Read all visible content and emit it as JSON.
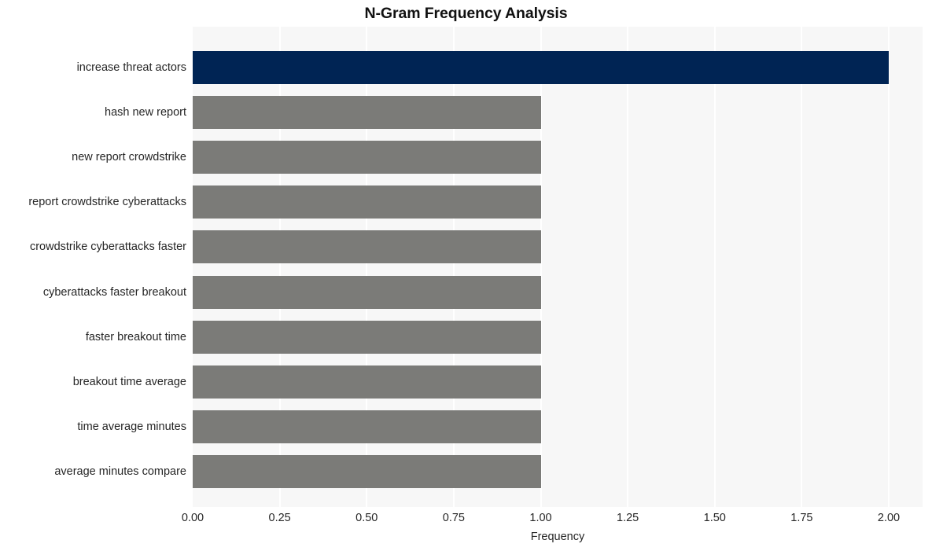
{
  "chart_data": {
    "type": "bar",
    "orientation": "horizontal",
    "title": "N-Gram Frequency Analysis",
    "xlabel": "Frequency",
    "ylabel": "",
    "categories": [
      "increase threat actors",
      "hash new report",
      "new report crowdstrike",
      "report crowdstrike cyberattacks",
      "crowdstrike cyberattacks faster",
      "cyberattacks faster breakout",
      "faster breakout time",
      "breakout time average",
      "time average minutes",
      "average minutes compare"
    ],
    "values": [
      2,
      1,
      1,
      1,
      1,
      1,
      1,
      1,
      1,
      1
    ],
    "bar_colors": [
      "#002454",
      "#7b7b78",
      "#7b7b78",
      "#7b7b78",
      "#7b7b78",
      "#7b7b78",
      "#7b7b78",
      "#7b7b78",
      "#7b7b78",
      "#7b7b78"
    ],
    "xlim": [
      0,
      2
    ],
    "xticks": [
      0,
      0.25,
      0.5,
      0.75,
      1,
      1.25,
      1.5,
      1.75,
      2
    ],
    "xtick_labels": [
      "0.00",
      "0.25",
      "0.50",
      "0.75",
      "1.00",
      "1.25",
      "1.50",
      "1.75",
      "2.00"
    ],
    "grid": true,
    "grid_axis": "x",
    "grid_color": "#ffffff",
    "legend": null,
    "plot_background": "#f7f7f7",
    "figure_background": "#ffffff",
    "highlight_color": "#002454",
    "default_bar_color": "#7b7b78"
  }
}
